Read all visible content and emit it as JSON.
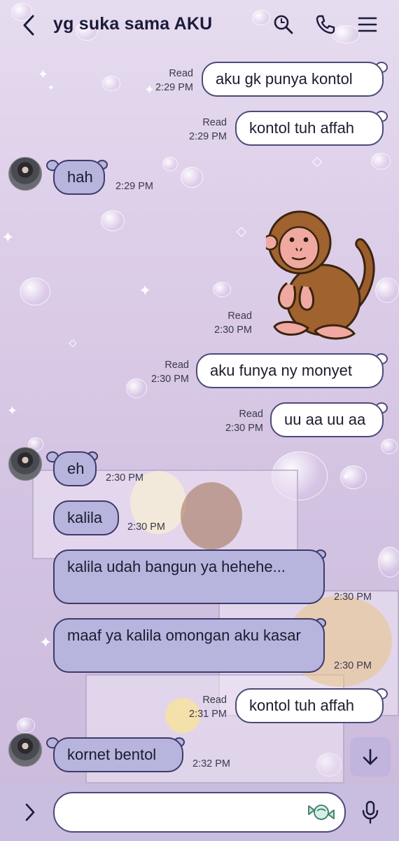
{
  "header": {
    "title": "yg suka sama AKU",
    "icons": [
      "back-icon",
      "search-icon",
      "phone-icon",
      "menu-icon"
    ]
  },
  "messages": [
    {
      "id": "m1",
      "direction": "out",
      "text": "aku gk punya kontol",
      "status": "Read",
      "time": "2:29 PM"
    },
    {
      "id": "m2",
      "direction": "out",
      "text": "kontol tuh affah",
      "status": "Read",
      "time": "2:29 PM"
    },
    {
      "id": "m3",
      "direction": "in",
      "text": "hah",
      "time": "2:29 PM"
    },
    {
      "id": "m4",
      "direction": "out",
      "type": "sticker",
      "sticker": "monkey-sticker",
      "status": "Read",
      "time": "2:30 PM"
    },
    {
      "id": "m5",
      "direction": "out",
      "text": "aku funya ny monyet",
      "status": "Read",
      "time": "2:30 PM"
    },
    {
      "id": "m6",
      "direction": "out",
      "text": "uu aa uu aa",
      "status": "Read",
      "time": "2:30 PM"
    },
    {
      "id": "m7",
      "direction": "in",
      "text": "eh",
      "time": "2:30 PM"
    },
    {
      "id": "m8",
      "direction": "in",
      "text": "kalila",
      "time": "2:30 PM"
    },
    {
      "id": "m9",
      "direction": "in",
      "text": "kalila udah bangun ya hehehe...",
      "time": "2:30 PM"
    },
    {
      "id": "m10",
      "direction": "in",
      "text": "maaf ya kalila omongan aku kasar",
      "time": "2:30 PM"
    },
    {
      "id": "m11",
      "direction": "out",
      "text": "kontol tuh affah",
      "status": "Read",
      "time": "2:31 PM"
    },
    {
      "id": "m12",
      "direction": "in",
      "text": "kornet bentol",
      "time": "2:32 PM"
    }
  ],
  "composer": {
    "placeholder": "",
    "icons": [
      "expand-icon",
      "emoji-icon",
      "mic-icon"
    ]
  },
  "colors": {
    "outgoing_bubble": "#ffffff",
    "incoming_bubble": "#b7b4de",
    "bubble_border": "#4d4a78",
    "background": "#d9cbe6"
  }
}
